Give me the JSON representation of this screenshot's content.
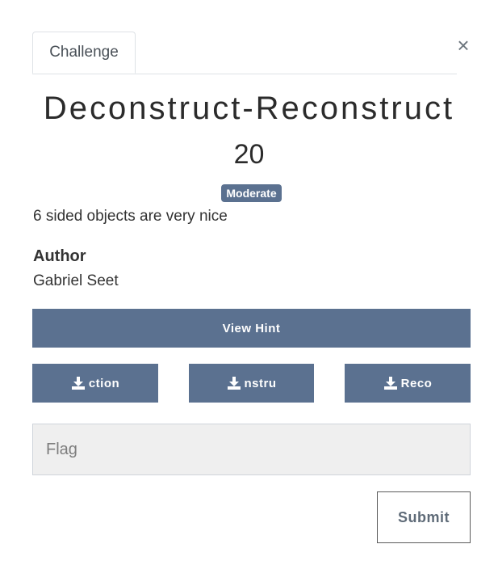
{
  "tabs": [
    {
      "label": "Challenge"
    }
  ],
  "close_symbol": "×",
  "challenge": {
    "title": "Deconstruct-Reconstruct",
    "points": "20",
    "difficulty": "Moderate",
    "description": "6 sided objects are very nice",
    "author_label": "Author",
    "author_name": "Gabriel Seet"
  },
  "buttons": {
    "hint_label": "View Hint",
    "files": [
      {
        "label": "ction",
        "icon": "download-icon"
      },
      {
        "label": "nstru",
        "icon": "download-icon"
      },
      {
        "label": "Reco",
        "icon": "download-icon"
      }
    ],
    "submit_label": "Submit"
  },
  "flag_input": {
    "placeholder": "Flag",
    "value": ""
  },
  "colors": {
    "accent": "#5b7190",
    "input_bg": "#efefef"
  }
}
